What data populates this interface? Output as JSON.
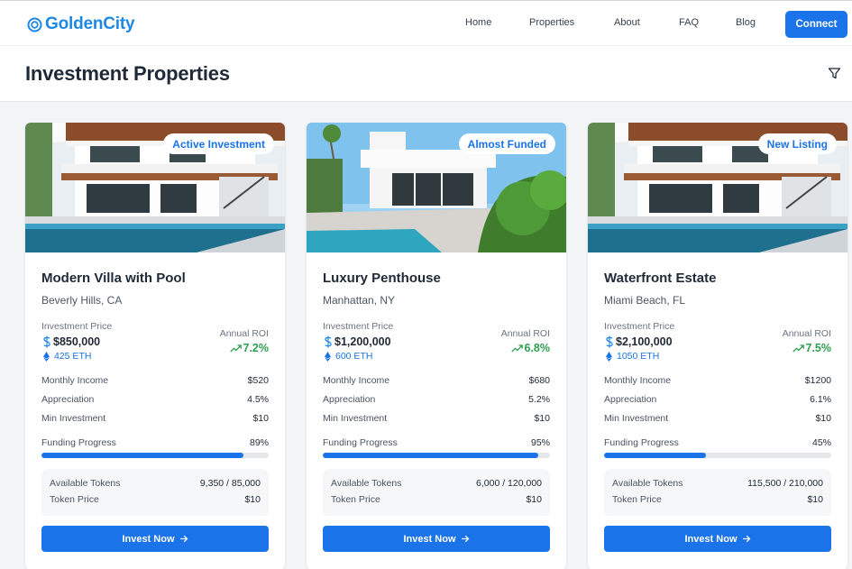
{
  "brand": {
    "name": "GoldenCity"
  },
  "nav": {
    "links": [
      "Home",
      "Properties",
      "About",
      "FAQ",
      "Blog"
    ],
    "connect_label": "Connect"
  },
  "header": {
    "title": "Investment Properties"
  },
  "icons": {
    "logo": "ring-logo-icon",
    "filter": "filter-icon",
    "usd": "dollar-icon",
    "eth": "ethereum-icon",
    "roi": "trending-up-icon",
    "arrow": "arrow-right-icon"
  },
  "colors": {
    "accent": "#1a73e8",
    "logo": "#1e88e5",
    "roi": "#2e9e4f"
  },
  "properties": [
    {
      "badge": "Active Investment",
      "title": "Modern Villa with Pool",
      "location": "Beverly Hills, CA",
      "investment_label": "Investment Price",
      "price": "$850,000",
      "eth": "425 ETH",
      "roi_label": "Annual ROI",
      "roi": "7.2%",
      "stats": [
        {
          "label": "Monthly Income",
          "value": "$520"
        },
        {
          "label": "Appreciation",
          "value": "4.5%"
        },
        {
          "label": "Min Investment",
          "value": "$10"
        }
      ],
      "progress_label": "Funding Progress",
      "progress_text": "89%",
      "progress": 0.89,
      "tokens_label": "Available Tokens",
      "tokens_value": "9,350 / 85,000",
      "token_price_label": "Token Price",
      "token_price": "$10",
      "button": "Invest Now"
    },
    {
      "badge": "Almost Funded",
      "title": "Luxury Penthouse",
      "location": "Manhattan, NY",
      "investment_label": "Investment Price",
      "price": "$1,200,000",
      "eth": "600 ETH",
      "roi_label": "Annual ROI",
      "roi": "6.8%",
      "stats": [
        {
          "label": "Monthly Income",
          "value": "$680"
        },
        {
          "label": "Appreciation",
          "value": "5.2%"
        },
        {
          "label": "Min Investment",
          "value": "$10"
        }
      ],
      "progress_label": "Funding Progress",
      "progress_text": "95%",
      "progress": 0.95,
      "tokens_label": "Available Tokens",
      "tokens_value": "6,000 / 120,000",
      "token_price_label": "Token Price",
      "token_price": "$10",
      "button": "Invest Now"
    },
    {
      "badge": "New Listing",
      "title": "Waterfront Estate",
      "location": "Miami Beach, FL",
      "investment_label": "Investment Price",
      "price": "$2,100,000",
      "eth": "1050 ETH",
      "roi_label": "Annual ROI",
      "roi": "7.5%",
      "stats": [
        {
          "label": "Monthly Income",
          "value": "$1200"
        },
        {
          "label": "Appreciation",
          "value": "6.1%"
        },
        {
          "label": "Min Investment",
          "value": "$10"
        }
      ],
      "progress_label": "Funding Progress",
      "progress_text": "45%",
      "progress": 0.45,
      "tokens_label": "Available Tokens",
      "tokens_value": "115,500 / 210,000",
      "token_price_label": "Token Price",
      "token_price": "$10",
      "button": "Invest Now"
    }
  ]
}
